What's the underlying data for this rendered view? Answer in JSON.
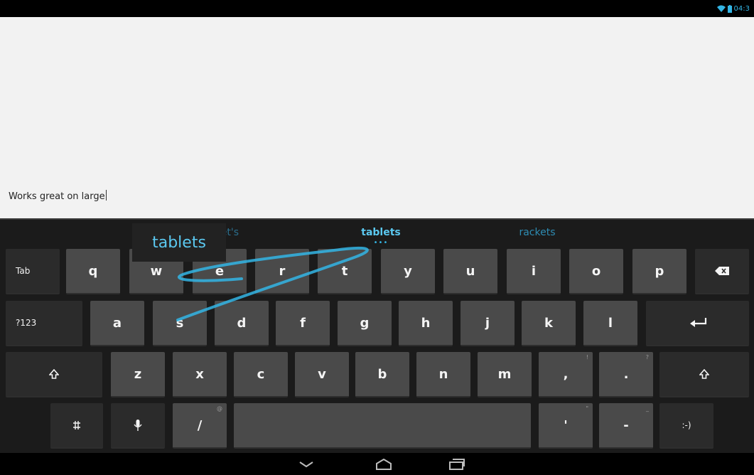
{
  "status_bar": {
    "time": "04:3",
    "icons": [
      "wifi-icon",
      "battery-icon"
    ]
  },
  "editor": {
    "text": "Works great on large"
  },
  "suggestions": {
    "items": [
      "tablet's",
      "tablets",
      "rackets"
    ],
    "preview": "tablets"
  },
  "keyboard": {
    "row1": [
      "Tab",
      "q",
      "w",
      "e",
      "r",
      "t",
      "y",
      "u",
      "i",
      "o",
      "p"
    ],
    "row2": [
      "?123",
      "a",
      "s",
      "d",
      "f",
      "g",
      "h",
      "j",
      "k",
      "l"
    ],
    "row3": [
      "z",
      "x",
      "c",
      "v",
      "b",
      "n",
      "m",
      ",",
      "."
    ],
    "row3_hints": {
      "comma": "!",
      "period": "?"
    },
    "row4": {
      "slash": "/",
      "slash_hint": "@",
      "apostrophe": "'",
      "apostrophe_hint": "\"",
      "dash": "-",
      "dash_hint": "_",
      "smiley": ":-)"
    }
  },
  "icons": {
    "delete": "backspace-icon",
    "enter": "enter-icon",
    "shift": "shift-icon",
    "settings": "settings-icon",
    "mic": "microphone-icon",
    "nav": [
      "back-down-icon",
      "home-icon",
      "recent-apps-icon"
    ]
  },
  "colors": {
    "accent": "#33b5e5",
    "key": "#4a4a4a",
    "func_key": "#2b2b2b",
    "keyboard_bg": "#1b1b1b",
    "text_bg": "#f2f2f2"
  }
}
